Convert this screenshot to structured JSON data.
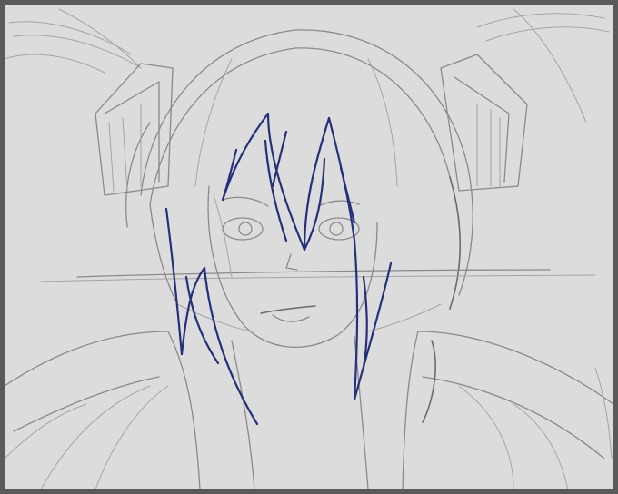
{
  "colors": {
    "frame": "#5a5a5a",
    "canvas": "#dcdcdc",
    "sketch_line": "#8a8a8a",
    "ink_line": "#24307a"
  }
}
